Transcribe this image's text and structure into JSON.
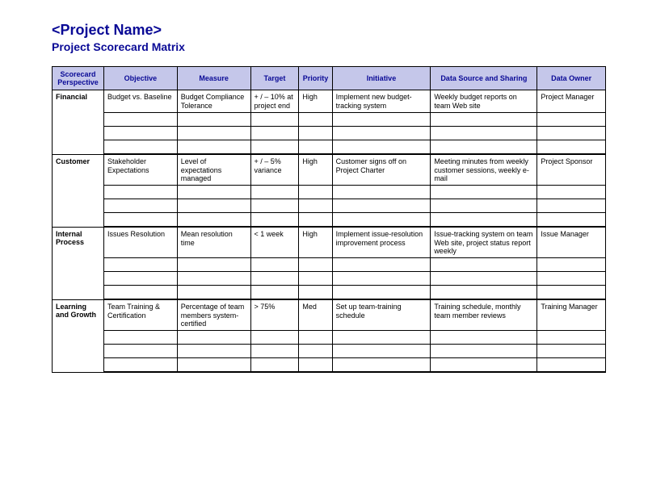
{
  "header": {
    "title": "<Project Name>",
    "subtitle": "Project Scorecard Matrix"
  },
  "columns": {
    "perspective": "Scorecard Perspective",
    "objective": "Objective",
    "measure": "Measure",
    "target": "Target",
    "priority": "Priority",
    "initiative": "Initiative",
    "data_source": "Data Source and Sharing",
    "owner": "Data Owner"
  },
  "groups": [
    {
      "perspective": "Financial",
      "rows": [
        {
          "objective": "Budget vs. Baseline",
          "measure": "Budget Compliance Tolerance",
          "target": "+ / – 10% at project end",
          "priority": "High",
          "initiative": "Implement new budget-tracking system",
          "data_source": "Weekly budget reports on team Web site",
          "owner": "Project Manager"
        },
        {},
        {},
        {}
      ]
    },
    {
      "perspective": "Customer",
      "rows": [
        {
          "objective": "Stakeholder Expectations",
          "measure": "Level of expectations managed",
          "target": "+ / – 5% variance",
          "priority": "High",
          "initiative": "Customer signs off on Project Charter",
          "data_source": "Meeting minutes from weekly customer sessions, weekly e-mail",
          "owner": "Project Sponsor"
        },
        {},
        {},
        {}
      ]
    },
    {
      "perspective": "Internal Process",
      "rows": [
        {
          "objective": "Issues Resolution",
          "measure": "Mean resolution time",
          "target": "< 1 week",
          "priority": "High",
          "initiative": "Implement issue-resolution improvement process",
          "data_source": "Issue-tracking system on team Web site, project status report weekly",
          "owner": "Issue Manager"
        },
        {},
        {},
        {}
      ]
    },
    {
      "perspective": "Learning and Growth",
      "rows": [
        {
          "objective": "Team Training & Certification",
          "measure": "Percentage of team members system-certified",
          "target": "> 75%",
          "priority": "Med",
          "initiative": "Set up team-training schedule",
          "data_source": "Training schedule, monthly team member reviews",
          "owner": "Training Manager"
        },
        {},
        {},
        {}
      ]
    }
  ]
}
